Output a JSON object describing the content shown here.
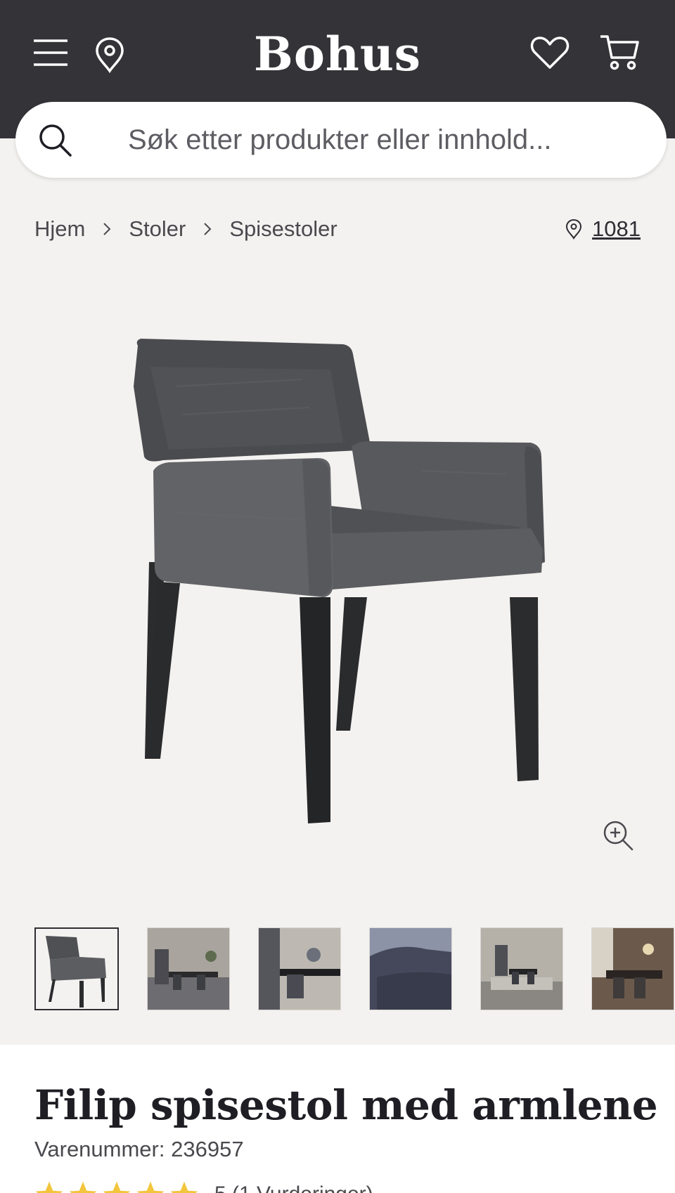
{
  "header": {
    "logo": "Bohus",
    "menu_icon": "hamburger-menu-icon",
    "location_icon": "map-pin-icon",
    "wishlist_icon": "heart-icon",
    "cart_icon": "shopping-cart-icon",
    "background": "#343338"
  },
  "search": {
    "placeholder": "Søk etter produkter eller innhold...",
    "icon": "search-icon"
  },
  "breadcrumb": {
    "items": [
      "Hjem",
      "Stoler",
      "Spisestoler"
    ],
    "separator_icon": "chevron-right-icon"
  },
  "store_location": {
    "icon": "map-pin-icon",
    "code": "1081"
  },
  "product": {
    "title": "Filip spisestol med armlene",
    "sku_label": "Varenummer:",
    "sku": "236957",
    "rating_stars": 5,
    "rating_count_text": "5 (1 Vurderinger)",
    "star_color": "#f2c53d"
  },
  "gallery": {
    "zoom_icon": "zoom-in-icon",
    "thumbnail_count": 6,
    "selected_index": 0
  },
  "colors": {
    "page_bg": "#f4f2f0",
    "chair_fabric": "#55565a",
    "chair_legs": "#2b2c2e"
  }
}
